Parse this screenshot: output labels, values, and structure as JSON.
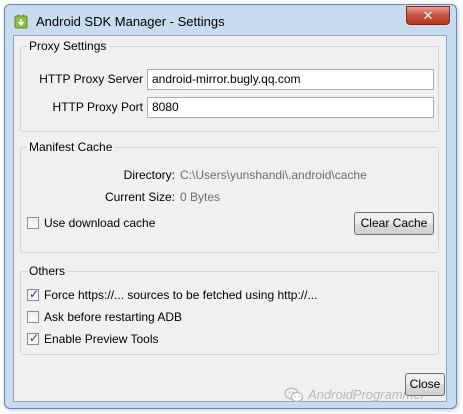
{
  "window": {
    "title": "Android SDK Manager - Settings",
    "close_glyph": "✕"
  },
  "proxy": {
    "group_title": "Proxy Settings",
    "server_label": "HTTP Proxy Server",
    "server_value": "android-mirror.bugly.qq.com",
    "port_label": "HTTP Proxy Port",
    "port_value": "8080"
  },
  "manifest": {
    "group_title": "Manifest Cache",
    "directory_label": "Directory:",
    "directory_value": "C:\\Users\\yunshandi\\.android\\cache",
    "size_label": "Current Size:",
    "size_value": "0 Bytes",
    "use_cache_label": "Use download cache",
    "use_cache_checked": false,
    "clear_cache_button": "Clear Cache"
  },
  "others": {
    "group_title": "Others",
    "options": [
      {
        "label": "Force https://... sources to be fetched using http://...",
        "checked": true
      },
      {
        "label": "Ask before restarting ADB",
        "checked": false
      },
      {
        "label": "Enable Preview Tools",
        "checked": true
      }
    ]
  },
  "footer": {
    "watermark": "AndroidProgrammer",
    "close_button": "Close"
  },
  "icons": {
    "app": "android-sdk-download-icon",
    "watermark": "wechat-icon",
    "check": "✓"
  }
}
